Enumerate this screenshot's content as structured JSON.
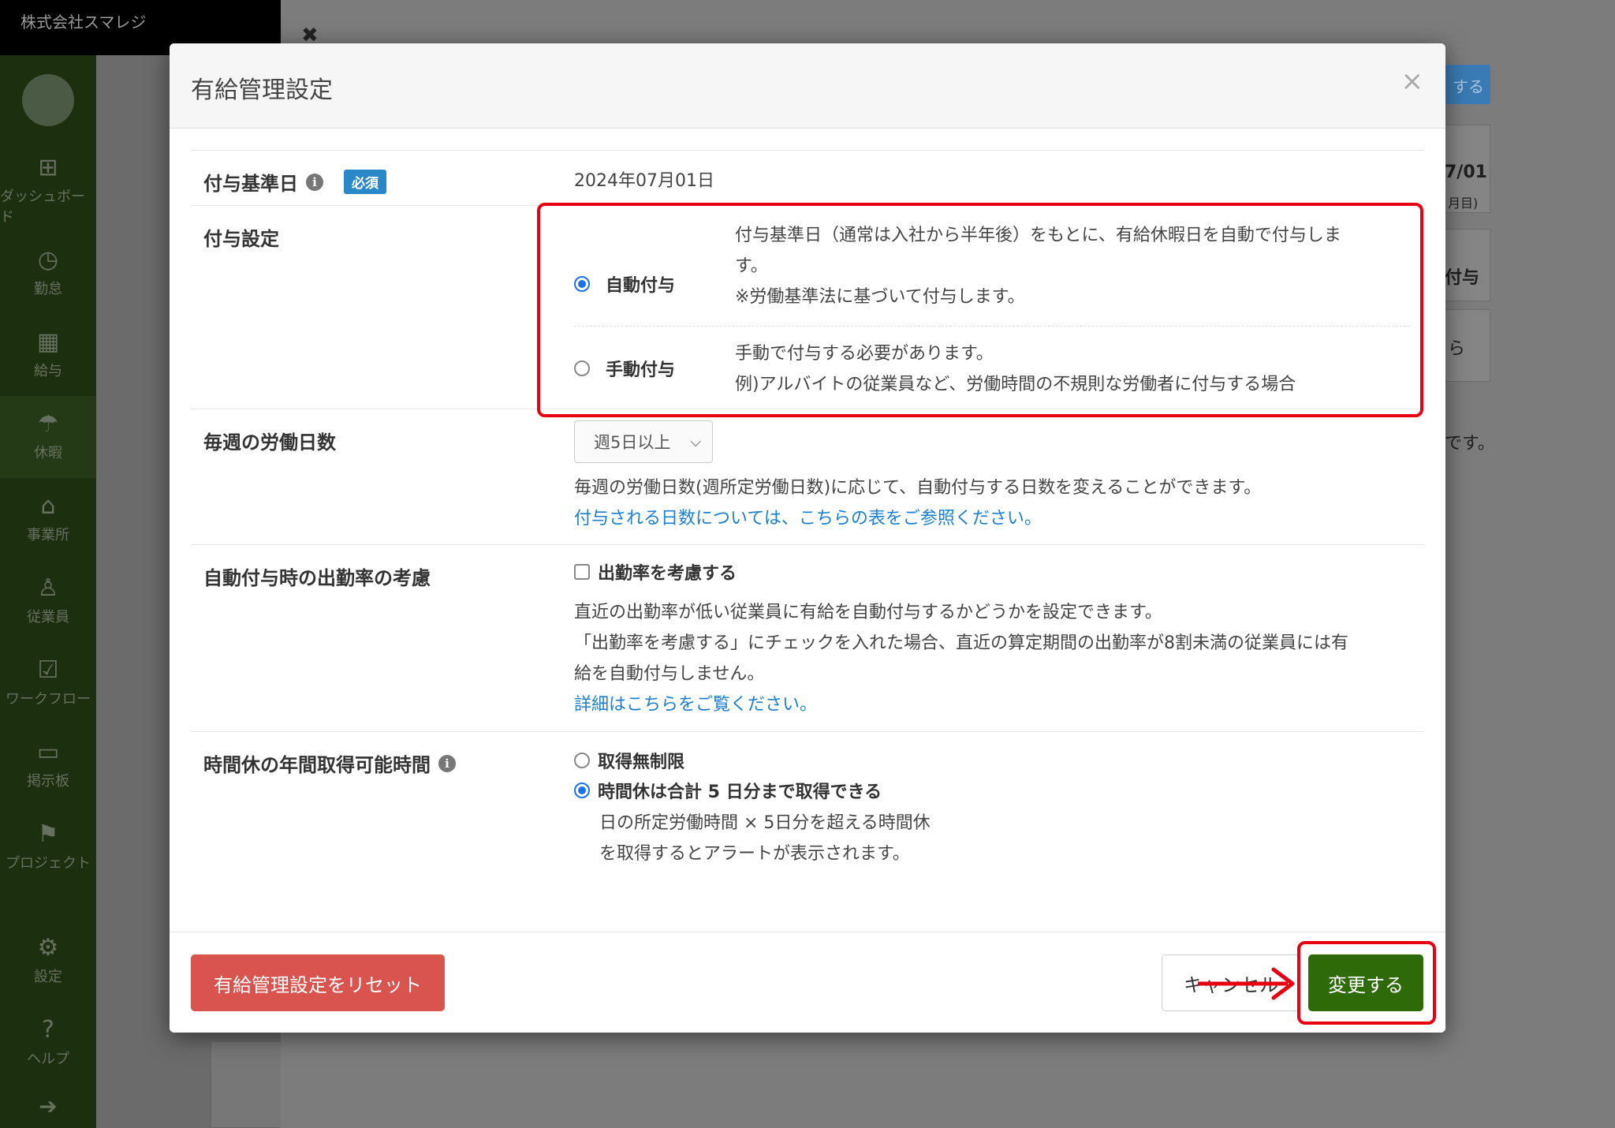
{
  "app": {
    "company_name": "株式会社スマレジ"
  },
  "sidebar": {
    "items": [
      {
        "label": "ダッシュボード",
        "icon": "dashboard-icon"
      },
      {
        "label": "勤怠",
        "icon": "clock-icon"
      },
      {
        "label": "給与",
        "icon": "calculator-icon"
      },
      {
        "label": "休暇",
        "icon": "umbrella-icon"
      },
      {
        "label": "事業所",
        "icon": "home-icon"
      },
      {
        "label": "従業員",
        "icon": "person-icon"
      },
      {
        "label": "ワークフロー",
        "icon": "checklist-icon"
      },
      {
        "label": "掲示板",
        "icon": "message-icon"
      },
      {
        "label": "プロジェクト",
        "icon": "flag-icon"
      },
      {
        "label": "設定",
        "icon": "gear-icon"
      },
      {
        "label": "ヘルプ",
        "icon": "help-icon"
      }
    ]
  },
  "background": {
    "button_label": "する",
    "date_fragment": "7/01",
    "date_sub": "月目)",
    "grant_fragment": "付与",
    "copy_fragment": "ら",
    "sentence_fragment": "です。"
  },
  "modal": {
    "title": "有給管理設定",
    "close_icon": "×",
    "grant_base_date": {
      "label": "付与基準日",
      "required_badge": "必須",
      "value": "2024年07月01日"
    },
    "grant_setting": {
      "label": "付与設定",
      "options": [
        {
          "label": "自動付与",
          "checked": true,
          "desc_lines": [
            "付与基準日（通常は入社から半年後）をもとに、有給休暇日を自動で付与しま",
            "す。",
            "※労働基準法に基づいて付与します。"
          ]
        },
        {
          "label": "手動付与",
          "checked": false,
          "desc_lines": [
            "手動で付与する必要があります。",
            "例)アルバイトの従業員など、労働時間の不規則な労働者に付与する場合"
          ]
        }
      ]
    },
    "weekly_days": {
      "label": "毎週の労働日数",
      "selected": "週5日以上",
      "desc": "毎週の労働日数(週所定労働日数)に応じて、自動付与する日数を変えることができます。",
      "link": "付与される日数については、こちらの表をご参照ください。"
    },
    "attendance_rate": {
      "label": "自動付与時の出勤率の考慮",
      "checkbox_label": "出勤率を考慮する",
      "checked": false,
      "desc_lines": [
        "直近の出勤率が低い従業員に有給を自動付与するかどうかを設定できます。",
        "「出勤率を考慮する」にチェックを入れた場合、直近の算定期間の出勤率が8割未満の従業員には有",
        "給を自動付与しません。"
      ],
      "link": "詳細はこちらをご覧ください。"
    },
    "hourly_leave": {
      "label": "時間休の年間取得可能時間",
      "options": [
        {
          "label": "取得無制限",
          "checked": false
        },
        {
          "label": "時間休は合計 5 日分まで取得できる",
          "checked": true
        }
      ],
      "note_lines": [
        "日の所定労働時間 × 5日分を超える時間休",
        "を取得するとアラートが表示されます。"
      ]
    },
    "footer": {
      "reset_label": "有給管理設定をリセット",
      "cancel_label": "キャンセル",
      "submit_label": "変更する"
    }
  },
  "colors": {
    "highlight": "#e60012",
    "primary_green": "#2f6a09",
    "danger_red": "#d9534f",
    "link_blue": "#1a7fd1",
    "badge_blue": "#2b88c8"
  }
}
